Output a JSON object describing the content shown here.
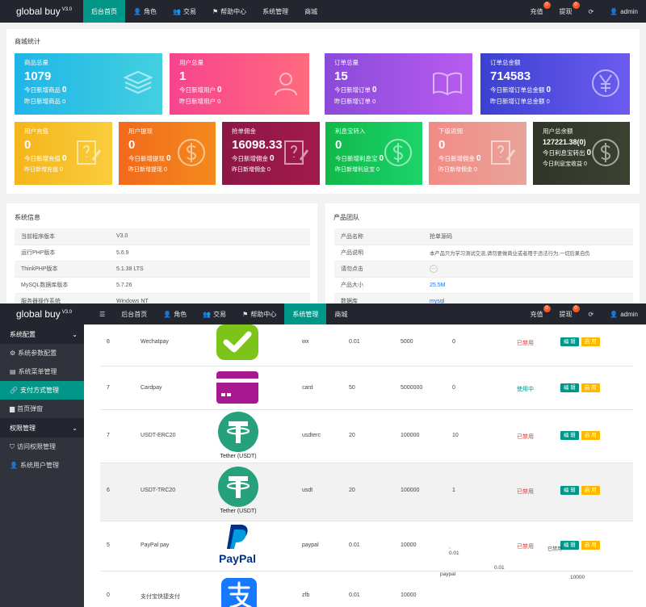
{
  "top_nav": {
    "brand": "global buy",
    "version": "V3.0",
    "items": [
      "后台首页",
      "角色",
      "交易",
      "帮助中心",
      "系统管理",
      "商城"
    ],
    "recharge": "充值",
    "withdraw": "提现",
    "badge": "0",
    "user": "admin"
  },
  "stats": {
    "title": "商城统计",
    "cards": [
      {
        "label": "商品总量",
        "value": "1079",
        "today": "今日新增商品",
        "today_val": "0",
        "yesterday": "昨日新增商品",
        "yesterday_val": "0",
        "icon": "layers-icon"
      },
      {
        "label": "用户总量",
        "value": "1",
        "today": "今日新增用户",
        "today_val": "0",
        "yesterday": "昨日新增用户",
        "yesterday_val": "0",
        "icon": "user-icon"
      },
      {
        "label": "订单总量",
        "value": "15",
        "today": "今日新增订单",
        "today_val": "0",
        "yesterday": "昨日新增订单",
        "yesterday_val": "0",
        "icon": "book-icon"
      },
      {
        "label": "订单总金额",
        "value": "714583",
        "today": "今日新增订单总金额",
        "today_val": "0",
        "yesterday": "昨日新增订单总金额",
        "yesterday_val": "0",
        "icon": "yen-icon"
      },
      {
        "label": "用户充值",
        "value": "0",
        "today": "今日新增充值",
        "today_val": "0",
        "yesterday": "昨日新增充值",
        "yesterday_val": "0",
        "icon": "note-icon"
      },
      {
        "label": "用户提现",
        "value": "0",
        "today": "今日新增提现",
        "today_val": "0",
        "yesterday": "昨日新增提现",
        "yesterday_val": "0",
        "icon": "dollar-icon"
      },
      {
        "label": "抢单佣金",
        "value": "16098.33",
        "today": "今日新增佣金",
        "today_val": "0",
        "yesterday": "昨日新增佣金",
        "yesterday_val": "0",
        "icon": "note-icon"
      },
      {
        "label": "利息宝转入",
        "value": "0",
        "today": "今日新增利息宝",
        "today_val": "0",
        "yesterday": "昨日新增利息宝",
        "yesterday_val": "0",
        "icon": "dollar-icon"
      },
      {
        "label": "下级返佣",
        "value": "0",
        "today": "今日新增佣金",
        "today_val": "0",
        "yesterday": "昨日新增佣金",
        "yesterday_val": "0",
        "icon": "note-icon"
      },
      {
        "label": "用户总余额",
        "value": "127221.38(0)",
        "today": "今日利息宝转出",
        "today_val": "0",
        "yesterday": "今日利息宝收益",
        "yesterday_val": "0",
        "icon": "dollar-icon"
      }
    ],
    "colors": [
      "#1fb5e8",
      "#f7438f",
      "#8a4ad9",
      "#3a41d1",
      "#f5b51a",
      "#f2691b",
      "#8d1746",
      "#12b84a",
      "#f28b85",
      "#2f3628"
    ]
  },
  "system_info": {
    "title": "系统信息",
    "rows": [
      [
        "当前程序版本",
        "V3.0"
      ],
      [
        "运行PHP版本",
        "5.6.9"
      ],
      [
        "ThinkPHP版本",
        "5.1.38 LTS"
      ],
      [
        "MySQL数据库版本",
        "5.7.26"
      ],
      [
        "服务器操作系统",
        "Windows NT"
      ]
    ]
  },
  "product_team": {
    "title": "产品团队",
    "rows": [
      [
        "产品名称",
        "抢单源码"
      ],
      [
        "产品说明",
        "本产品只为学习测试交流,请勿要做商业或者用于违法行为,一切后果自负"
      ],
      [
        "请勿点击",
        "---"
      ],
      [
        "产品大小",
        "25.5M"
      ],
      [
        "数据库",
        "mysql"
      ]
    ]
  },
  "second_window": {
    "nav_items": [
      "后台首页",
      "角色",
      "交易",
      "帮助中心",
      "系统管理",
      "商城"
    ],
    "sidebar": {
      "group1": "系统配置",
      "items1": [
        "系统参数配置",
        "系统菜单管理",
        "支付方式管理",
        "首页弹窗"
      ],
      "group2": "权限管理",
      "items2": [
        "访问权限管理",
        "系统用户管理"
      ]
    },
    "buttons": {
      "edit": "编 辑",
      "enable": "启 用"
    },
    "rows": [
      {
        "id": "8",
        "name": "Wechatpay",
        "code": "wx",
        "rate": "0.01",
        "max": "5000",
        "count": "0",
        "status": "已禁用",
        "logo": "wechat-logo"
      },
      {
        "id": "7",
        "name": "Cardpay",
        "code": "card",
        "rate": "50",
        "max": "5000000",
        "count": "0",
        "status": "使用中",
        "logo": "card-logo"
      },
      {
        "id": "7",
        "name": "USDT-ERC20",
        "code": "usdterc",
        "rate": "20",
        "max": "100000",
        "count": "10",
        "status": "已禁用",
        "logo": "tether-logo",
        "logo_caption": "Tether (USDT)"
      },
      {
        "id": "6",
        "name": "USDT-TRC20",
        "code": "usdt",
        "rate": "20",
        "max": "100000",
        "count": "1",
        "status": "已禁用",
        "logo": "tether-logo",
        "logo_caption": "Tether (USDT)"
      },
      {
        "id": "5",
        "name": "PayPal pay",
        "code": "paypal",
        "rate": "0.01",
        "max": "10000",
        "count": "",
        "status": "已禁用",
        "logo": "paypal-logo",
        "logo_caption": "PayPal"
      },
      {
        "id": "0",
        "name": "支付宝快捷支付",
        "code": "zfb",
        "rate": "0.01",
        "max": "10000",
        "count": "",
        "status": "",
        "logo": "alipay-logo"
      }
    ],
    "stray_texts": {
      "s1": "0.01",
      "s2": "paypal",
      "s3": "0.01",
      "s4": "10000",
      "s5": "已禁用",
      "s6": ","
    }
  }
}
